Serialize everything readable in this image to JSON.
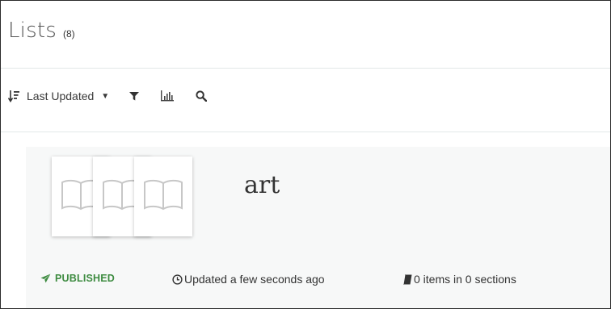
{
  "header": {
    "title": "Lists",
    "count": "(8)"
  },
  "toolbar": {
    "sort_icon": "sort-descending-icon",
    "sort_label": "Last Updated",
    "caret_icon": "caret-down-icon",
    "filter_icon": "filter-icon",
    "chart_icon": "bar-chart-icon",
    "search_icon": "search-icon"
  },
  "list_items": [
    {
      "title": "art",
      "status": "PUBLISHED",
      "status_icon": "paper-plane-icon",
      "updated": "Updated a few seconds ago",
      "updated_icon": "clock-icon",
      "items_summary": "0 items in 0 sections",
      "items_icon": "book-icon",
      "thumbnail_icon": "open-book-icon"
    }
  ],
  "colors": {
    "published": "#3d8b40",
    "card_background": "#f7f8f8",
    "divider": "#e3e8e8"
  }
}
